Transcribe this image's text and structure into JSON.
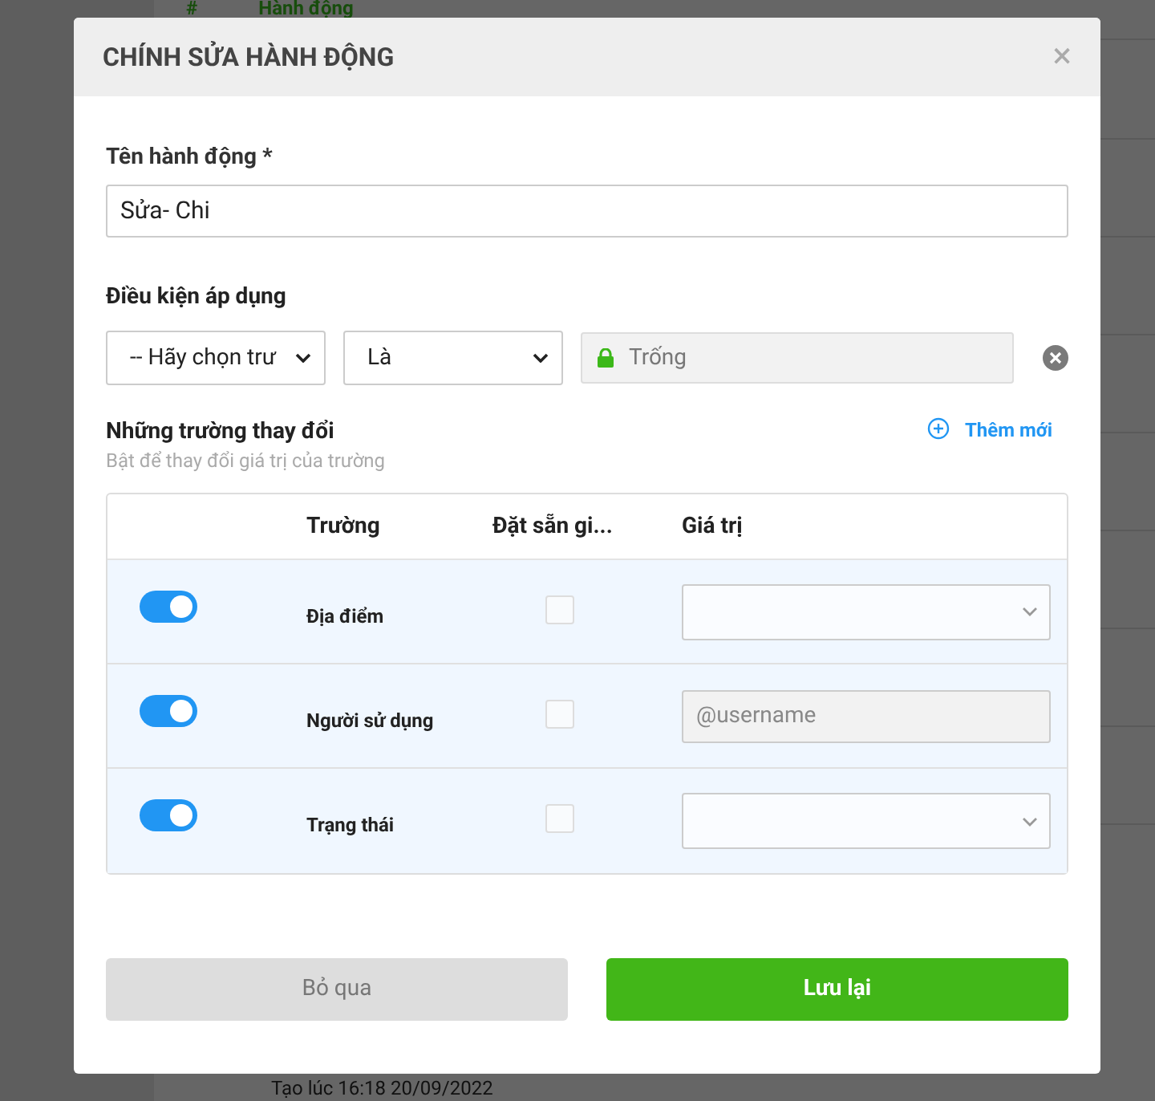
{
  "background": {
    "table_header": [
      "#",
      "Hành động"
    ],
    "footer_text": "Tạo lúc 16:18 20/09/2022"
  },
  "dialog": {
    "title": "CHÍNH SỬA HÀNH ĐỘNG",
    "close": "×"
  },
  "name_field": {
    "label": "Tên hành động *",
    "value": "Sửa- Chi"
  },
  "condition": {
    "label": "Điều kiện áp dụng",
    "field_select": "-- Hãy chọn trư",
    "operator_select": "Là",
    "value": "Trống",
    "locked": true
  },
  "changes": {
    "title": "Những trường thay đổi",
    "subtitle": "Bật để thay đổi giá trị của trường",
    "add_button": "Thêm mới",
    "columns": [
      "Trường",
      "Đặt sẵn gi...",
      "Giá trị"
    ],
    "rows": [
      {
        "on": true,
        "field": "Địa điểm",
        "preset": false,
        "kind": "select"
      },
      {
        "on": true,
        "field": "Người sử dụng",
        "preset": false,
        "kind": "text",
        "placeholder": "@username"
      },
      {
        "on": true,
        "field": "Trạng thái",
        "preset": false,
        "kind": "select"
      }
    ]
  },
  "buttons": [
    {
      "label": "Bỏ qua",
      "kind": "secondary"
    },
    {
      "label": "Lưu lại",
      "kind": "primary"
    }
  ]
}
